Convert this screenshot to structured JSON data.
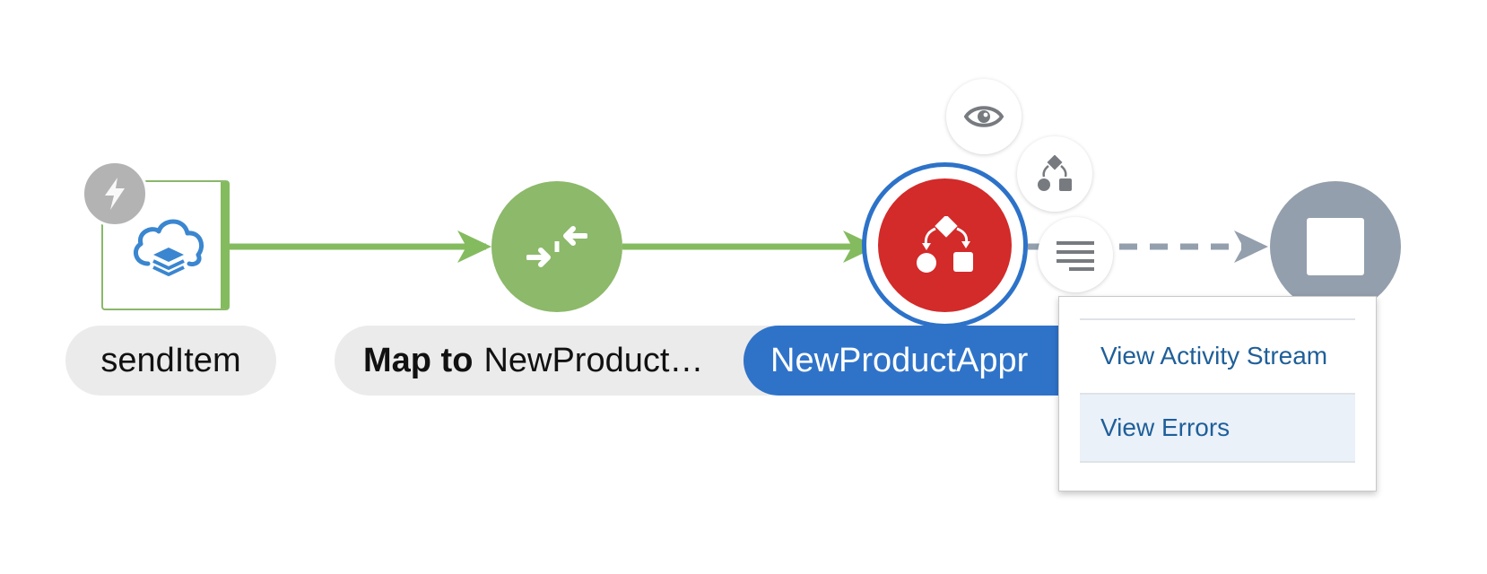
{
  "canvas": {
    "colors": {
      "success_node": "#8cb96a",
      "error_node": "#d32a2a",
      "selected_ring": "#2d72c8",
      "end_node": "#939fac",
      "label_bg": "#ebebeb",
      "selected_label_bg": "#2f73c9",
      "connector": "#84bb5f",
      "pending_connector": "#939fac"
    }
  },
  "nodes": {
    "trigger": {
      "label": "sendItem",
      "icon": "cloud-layers-icon",
      "badge_icon": "lightning-bolt-icon"
    },
    "map": {
      "label_bold": "Map to",
      "label_rest": "NewProduct…",
      "icon": "map-arrows-icon"
    },
    "process": {
      "label": "NewProductAppr",
      "icon": "process-shapes-icon",
      "status": "error"
    },
    "end": {
      "icon": "stop-square-icon"
    }
  },
  "actions": {
    "eye_icon": "eye-icon",
    "flow_icon": "process-flow-icon",
    "menu_icon": "hamburger-menu-icon"
  },
  "context_menu": {
    "items": [
      {
        "label": "View Activity Stream"
      },
      {
        "label": "View Errors"
      }
    ]
  }
}
